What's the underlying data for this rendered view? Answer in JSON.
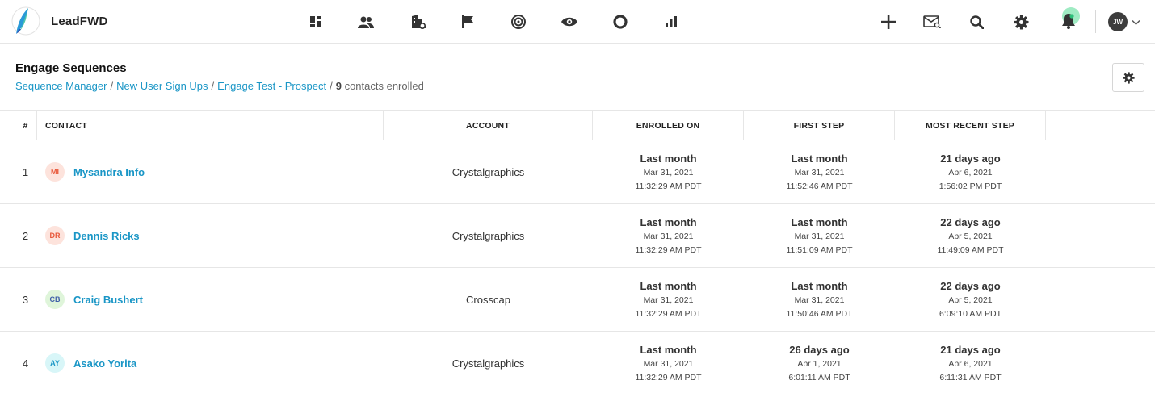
{
  "app": {
    "name": "LeadFWD",
    "user_initials": "JW"
  },
  "nav_icons": [
    "dashboard-icon",
    "people-icon",
    "accounts-icon",
    "flag-icon",
    "target-icon",
    "eye-icon",
    "circle-icon",
    "bar-chart-icon"
  ],
  "header": {
    "title": "Engage Sequences",
    "breadcrumb": [
      "Sequence Manager",
      "New User Sign Ups",
      "Engage Test - Prospect"
    ],
    "enrolled_count": "9",
    "enrolled_suffix": "contacts enrolled"
  },
  "table": {
    "columns": {
      "num": "#",
      "contact": "CONTACT",
      "account": "ACCOUNT",
      "enrolled": "ENROLLED ON",
      "first": "FIRST STEP",
      "recent": "MOST RECENT STEP"
    },
    "rows": [
      {
        "num": "1",
        "initials": "MI",
        "name": "Mysandra Info",
        "account": "Crystalgraphics",
        "enrolled": {
          "rel": "Last month",
          "date": "Mar 31, 2021",
          "time": "11:32:29 AM PDT"
        },
        "first": {
          "rel": "Last month",
          "date": "Mar 31, 2021",
          "time": "11:52:46 AM PDT"
        },
        "recent": {
          "rel": "21 days ago",
          "date": "Apr 6, 2021",
          "time": "1:56:02 PM PDT"
        }
      },
      {
        "num": "2",
        "initials": "DR",
        "name": "Dennis Ricks",
        "account": "Crystalgraphics",
        "enrolled": {
          "rel": "Last month",
          "date": "Mar 31, 2021",
          "time": "11:32:29 AM PDT"
        },
        "first": {
          "rel": "Last month",
          "date": "Mar 31, 2021",
          "time": "11:51:09 AM PDT"
        },
        "recent": {
          "rel": "22 days ago",
          "date": "Apr 5, 2021",
          "time": "11:49:09 AM PDT"
        }
      },
      {
        "num": "3",
        "initials": "CB",
        "name": "Craig Bushert",
        "account": "Crosscap",
        "enrolled": {
          "rel": "Last month",
          "date": "Mar 31, 2021",
          "time": "11:32:29 AM PDT"
        },
        "first": {
          "rel": "Last month",
          "date": "Mar 31, 2021",
          "time": "11:50:46 AM PDT"
        },
        "recent": {
          "rel": "22 days ago",
          "date": "Apr 5, 2021",
          "time": "6:09:10 AM PDT"
        }
      },
      {
        "num": "4",
        "initials": "AY",
        "name": "Asako Yorita",
        "account": "Crystalgraphics",
        "enrolled": {
          "rel": "Last month",
          "date": "Mar 31, 2021",
          "time": "11:32:29 AM PDT"
        },
        "first": {
          "rel": "26 days ago",
          "date": "Apr 1, 2021",
          "time": "6:01:11 AM PDT"
        },
        "recent": {
          "rel": "21 days ago",
          "date": "Apr 6, 2021",
          "time": "6:11:31 AM PDT"
        }
      }
    ]
  },
  "colors": {
    "accent": "#1a96c6",
    "avatar_mi_bg": "#fde3dc",
    "avatar_mi_fg": "#e8583b",
    "avatar_dr_bg": "#fde3dc",
    "avatar_dr_fg": "#e8583b",
    "avatar_cb_bg": "#dff5da",
    "avatar_cb_fg": "#3f5fa8",
    "avatar_ay_bg": "#d8f6f8",
    "avatar_ay_fg": "#1a96c6"
  }
}
